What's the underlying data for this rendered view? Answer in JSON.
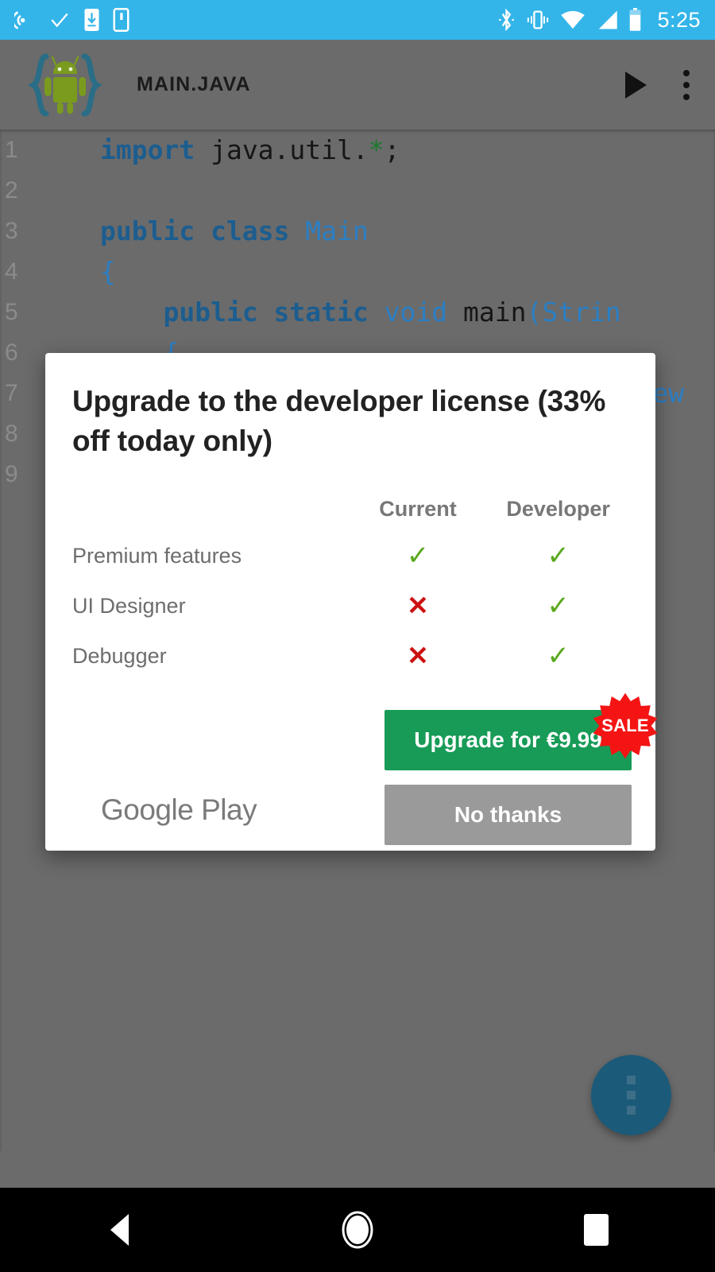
{
  "status_bar": {
    "background": "#33b5e9",
    "clock": "5:25",
    "left_icons": [
      "cast-icon",
      "check-icon",
      "phone-download-icon",
      "tablet-icon"
    ],
    "right_icons": [
      "bluetooth-icon",
      "vibrate-icon",
      "wifi-icon",
      "signal-icon",
      "battery-icon"
    ]
  },
  "app_bar": {
    "title": "MAIN.JAVA",
    "logo": "android-braces-logo",
    "run_icon": "play-icon",
    "overflow_icon": "overflow-menu-icon",
    "background": "#6b6b6b"
  },
  "editor": {
    "background": "#6b6b6b",
    "lines": [
      {
        "number": "1",
        "tokens": [
          {
            "t": "import ",
            "c": "kw"
          },
          {
            "t": "java.util.",
            "c": "pln"
          },
          {
            "t": "*",
            "c": "str"
          },
          {
            "t": ";",
            "c": "pln"
          }
        ]
      },
      {
        "number": "2",
        "tokens": []
      },
      {
        "number": "3",
        "tokens": [
          {
            "t": "public class ",
            "c": "kw"
          },
          {
            "t": "Main",
            "c": "typ"
          }
        ]
      },
      {
        "number": "4",
        "tokens": [
          {
            "t": "{",
            "c": "brc"
          }
        ]
      },
      {
        "number": "5",
        "tokens": [
          {
            "t": "    public static ",
            "c": "kw"
          },
          {
            "t": "void ",
            "c": "typ"
          },
          {
            "t": "main",
            "c": "pln"
          },
          {
            "t": "(",
            "c": "brc"
          },
          {
            "t": "Strin",
            "c": "typ"
          }
        ]
      },
      {
        "number": "6",
        "tokens": [
          {
            "t": "    {",
            "c": "brc"
          }
        ]
      },
      {
        "number": "7",
        "tokens": [
          {
            "t": "                                   ew",
            "c": "typ"
          }
        ]
      },
      {
        "number": "8",
        "tokens": []
      },
      {
        "number": "9",
        "tokens": []
      }
    ]
  },
  "dialog": {
    "title": "Upgrade to the developer license (33% off today only)",
    "table": {
      "columns": [
        "Current",
        "Developer"
      ],
      "rows": [
        {
          "feature": "Premium features",
          "current": "check",
          "developer": "check"
        },
        {
          "feature": "UI Designer",
          "current": "cross",
          "developer": "check"
        },
        {
          "feature": "Debugger",
          "current": "cross",
          "developer": "check"
        }
      ],
      "check_glyph": "✓",
      "cross_glyph": "✕",
      "check_color": "#5aa81e",
      "cross_color": "#cc1111"
    },
    "upgrade_button": {
      "label": "Upgrade for €9.99",
      "color": "#179b57"
    },
    "sale_badge": {
      "label": "SALE",
      "color": "#f41414"
    },
    "store_logo": "Google Play",
    "decline_button": {
      "label": "No thanks",
      "color": "#9a9a9a"
    }
  },
  "fab": {
    "icon": "overflow-menu-icon",
    "color": "#1b5a79"
  },
  "nav_bar": {
    "background": "#000000",
    "buttons": [
      "back-icon",
      "home-icon",
      "recents-icon"
    ]
  }
}
